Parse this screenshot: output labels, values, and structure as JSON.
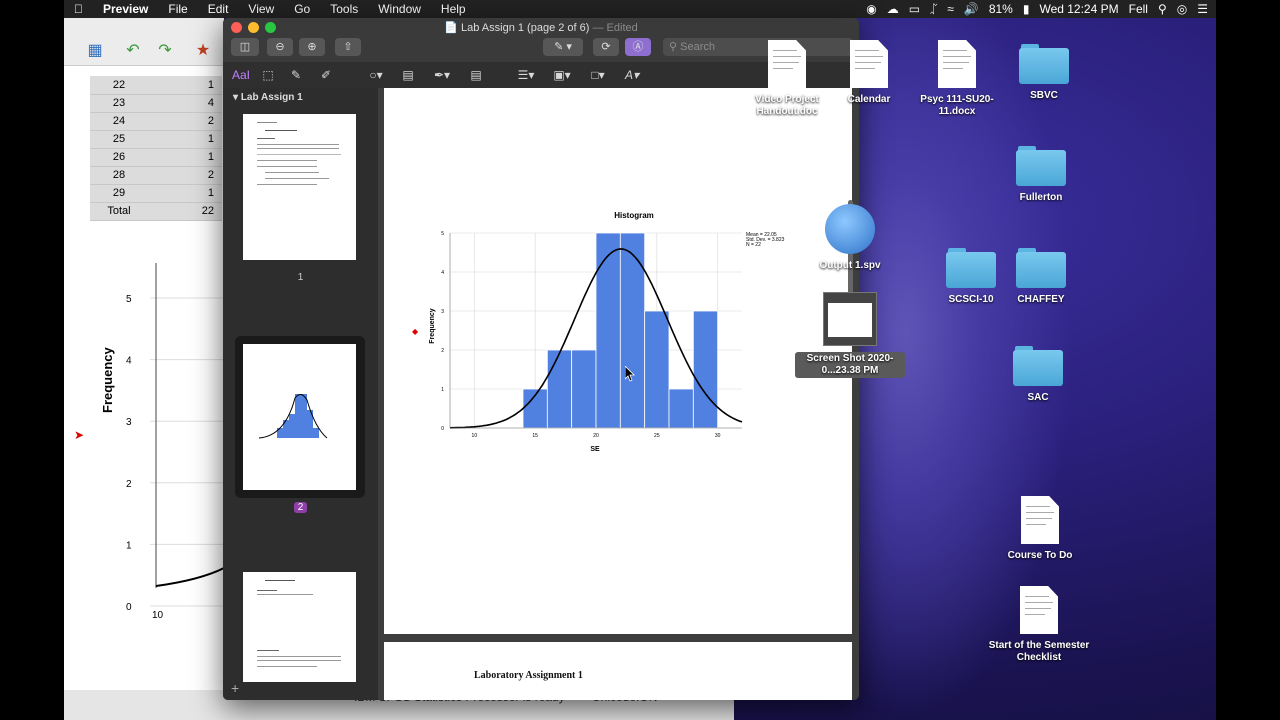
{
  "menubar": {
    "app": "Preview",
    "items": [
      "File",
      "Edit",
      "View",
      "Go",
      "Tools",
      "Window",
      "Help"
    ],
    "battery": "81%",
    "clock": "Wed 12:24 PM",
    "user": "Fell"
  },
  "spss": {
    "table_rows": [
      [
        "22",
        "1"
      ],
      [
        "23",
        "4"
      ],
      [
        "24",
        "2"
      ],
      [
        "25",
        "1"
      ],
      [
        "26",
        "1"
      ],
      [
        "28",
        "2"
      ],
      [
        "29",
        "1"
      ],
      [
        "Total",
        "22"
      ]
    ],
    "chart_ylabel": "Frequency",
    "yticks": [
      "5",
      "4",
      "3",
      "2",
      "1",
      "0"
    ],
    "xtick": "10",
    "status_text": "IBM SPSS Statistics Processor is ready",
    "unicode_text": "Unicode:ON"
  },
  "preview": {
    "title": "Lab Assign 1 (page 2 of 6)",
    "edited": "— Edited",
    "search_placeholder": "Search",
    "sidebar_header": "Lab Assign 1",
    "page_labels": [
      "1",
      "2"
    ],
    "page3_heading": "Laboratory Assignment 1"
  },
  "chart_data": {
    "type": "bar",
    "title": "Histogram",
    "xlabel": "SE",
    "ylabel": "Frequency",
    "bins": [
      {
        "x0": 14,
        "x1": 16,
        "value": 1
      },
      {
        "x0": 16,
        "x1": 18,
        "value": 2
      },
      {
        "x0": 18,
        "x1": 20,
        "value": 2
      },
      {
        "x0": 20,
        "x1": 22,
        "value": 5
      },
      {
        "x0": 22,
        "x1": 24,
        "value": 5
      },
      {
        "x0": 24,
        "x1": 26,
        "value": 3
      },
      {
        "x0": 26,
        "x1": 28,
        "value": 1
      },
      {
        "x0": 28,
        "x1": 30,
        "value": 3
      }
    ],
    "xlim": [
      8,
      32
    ],
    "ylim": [
      0,
      5
    ],
    "xticks": [
      10,
      15,
      20,
      25,
      30
    ],
    "yticks": [
      0,
      1,
      2,
      3,
      4,
      5
    ],
    "normal_curve": {
      "mean": 22.05,
      "sd": 3.823,
      "n": 22
    },
    "stats_lines": [
      "Mean = 22.05",
      "Std. Dev. = 3.823",
      "N = 22"
    ],
    "bar_color": "#5080e0"
  },
  "desktop": {
    "icons": [
      {
        "label": "Video Project Handout.doc",
        "kind": "doc"
      },
      {
        "label": "Calendar",
        "kind": "doc"
      },
      {
        "label": "Psyc 111-SU20-11.docx",
        "kind": "doc"
      },
      {
        "label": "SBVC",
        "kind": "folder"
      },
      {
        "label": "Fullerton",
        "kind": "folder"
      },
      {
        "label": "Output 1.spv",
        "kind": "app"
      },
      {
        "label": "Screen Shot 2020-0...23.38 PM",
        "kind": "image"
      },
      {
        "label": "SCSCI-10",
        "kind": "folder"
      },
      {
        "label": "CHAFFEY",
        "kind": "folder"
      },
      {
        "label": "SAC",
        "kind": "folder"
      },
      {
        "label": "Course To Do",
        "kind": "doc"
      },
      {
        "label": "Start of the Semester Checklist",
        "kind": "doc"
      }
    ]
  }
}
